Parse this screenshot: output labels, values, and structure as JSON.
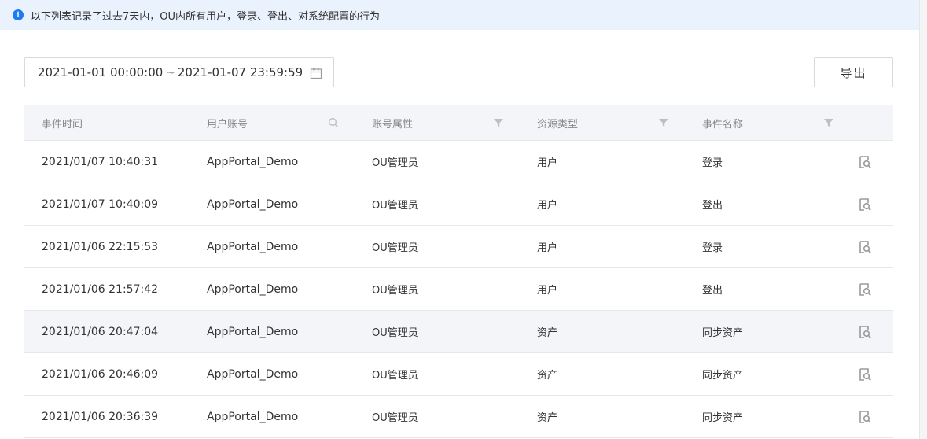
{
  "notice": {
    "icon": "info-icon",
    "text": "以下列表记录了过去7天内，OU内所有用户，登录、登出、对系统配置的行为"
  },
  "toolbar": {
    "date_start": "2021-01-01 00:00:00",
    "date_sep": "~",
    "date_end": "2021-01-07 23:59:59",
    "export_label": "导出"
  },
  "table": {
    "columns": [
      "事件时间",
      "用户账号",
      "账号属性",
      "资源类型",
      "事件名称"
    ],
    "rows": [
      {
        "time": "2021/01/07 10:40:31",
        "account": "AppPortal_Demo",
        "attr": "OU管理员",
        "resource": "用户",
        "event": "登录"
      },
      {
        "time": "2021/01/07 10:40:09",
        "account": "AppPortal_Demo",
        "attr": "OU管理员",
        "resource": "用户",
        "event": "登出"
      },
      {
        "time": "2021/01/06 22:15:53",
        "account": "AppPortal_Demo",
        "attr": "OU管理员",
        "resource": "用户",
        "event": "登录"
      },
      {
        "time": "2021/01/06 21:57:42",
        "account": "AppPortal_Demo",
        "attr": "OU管理员",
        "resource": "用户",
        "event": "登出"
      },
      {
        "time": "2021/01/06 20:47:04",
        "account": "AppPortal_Demo",
        "attr": "OU管理员",
        "resource": "资产",
        "event": "同步资产"
      },
      {
        "time": "2021/01/06 20:46:09",
        "account": "AppPortal_Demo",
        "attr": "OU管理员",
        "resource": "资产",
        "event": "同步资产"
      },
      {
        "time": "2021/01/06 20:36:39",
        "account": "AppPortal_Demo",
        "attr": "OU管理员",
        "resource": "资产",
        "event": "同步资产"
      }
    ],
    "highlighted_row": 4
  },
  "colors": {
    "accent": "#1e7bf0",
    "notice_bg": "#eaf2fd",
    "header_bg": "#f4f5f9"
  }
}
